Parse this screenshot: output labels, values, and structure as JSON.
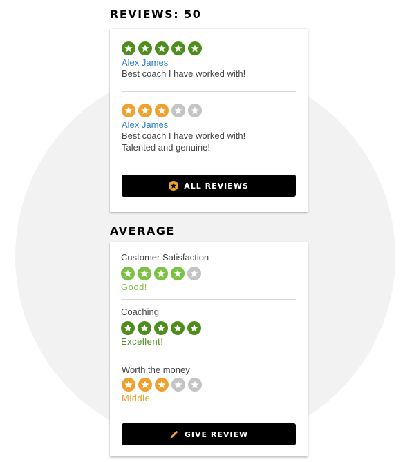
{
  "reviews": {
    "heading": "REVIEWS: 50",
    "items": [
      {
        "rating": 5,
        "author": "Alex James",
        "lines": [
          "Best coach I have worked with!"
        ]
      },
      {
        "rating": 3,
        "author": "Alex James",
        "lines": [
          "Best coach I have worked with!",
          "Talented and genuine!"
        ]
      }
    ],
    "all_reviews_label": "ALL REVIEWS"
  },
  "average": {
    "heading": "AVERAGE",
    "categories": [
      {
        "label": "Customer Satisfaction",
        "rating": 4,
        "verdict": "Good!"
      },
      {
        "label": "Coaching",
        "rating": 5,
        "verdict": "Excellent!"
      },
      {
        "label": "Worth the money",
        "rating": 3,
        "verdict": "Middle"
      }
    ],
    "give_review_label": "GIVE REVIEW"
  },
  "colors": {
    "star_five": "#4e8c1c",
    "star_four": "#7cc242",
    "star_three": "#f0a02b",
    "star_empty": "#c4c4c4",
    "verdict_good": "#7cc242",
    "verdict_excellent": "#4e8c1c",
    "verdict_middle": "#f0a02b",
    "link": "#2a7fc9"
  },
  "icons": {
    "star": "star-icon",
    "all_reviews": "star-badge-icon",
    "give_review": "pencil-icon"
  }
}
